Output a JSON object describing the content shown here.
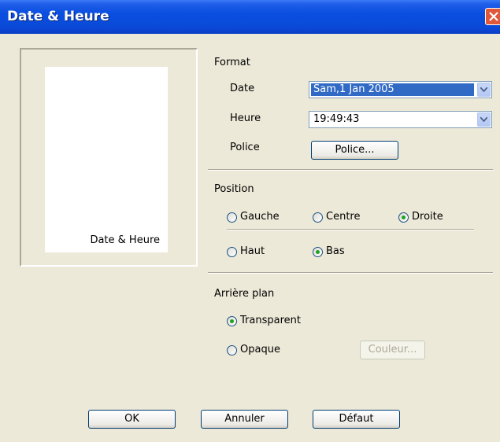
{
  "window": {
    "title": "Date & Heure"
  },
  "preview": {
    "label": "Date & Heure"
  },
  "format": {
    "heading": "Format",
    "date_label": "Date",
    "date_value": "Sam,1 Jan 2005",
    "time_label": "Heure",
    "time_value": "19:49:43",
    "font_label": "Police",
    "font_button": "Police..."
  },
  "position": {
    "heading": "Position",
    "left": "Gauche",
    "center": "Centre",
    "right": "Droite",
    "top": "Haut",
    "bottom": "Bas"
  },
  "background": {
    "heading": "Arrière plan",
    "transparent": "Transparent",
    "opaque": "Opaque",
    "color_button": "Couleur..."
  },
  "footer": {
    "ok": "OK",
    "cancel": "Annuler",
    "default": "Défaut"
  },
  "colors": {
    "titlebar": "#0a4ee0",
    "selection": "#316ac5",
    "radio_dot": "#21a121"
  }
}
